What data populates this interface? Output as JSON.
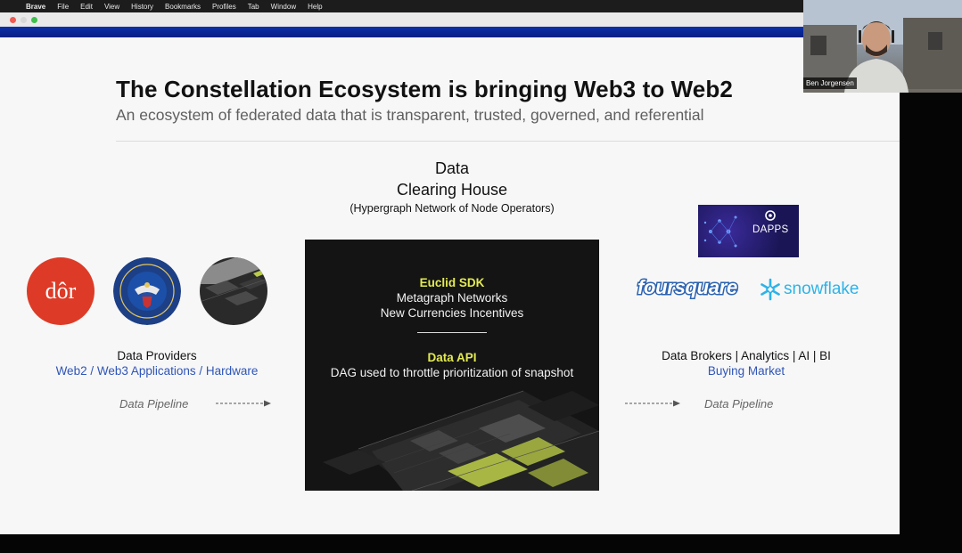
{
  "menubar": {
    "items": [
      "Brave",
      "File",
      "Edit",
      "View",
      "History",
      "Bookmarks",
      "Profiles",
      "Tab",
      "Window",
      "Help"
    ]
  },
  "slide": {
    "title": "The Constellation Ecosystem is bringing Web3 to Web2",
    "subtitle": "An ecosystem of federated data that is transparent, trusted, governed, and referential",
    "clearing_house": {
      "line1": "Data",
      "line2": "Clearing House",
      "line3": "(Hypergraph Network of Node Operators)"
    },
    "panel": {
      "sdk_title": "Euclid SDK",
      "sdk_line1": "Metagraph Networks",
      "sdk_line2": "New Currencies Incentives",
      "api_title": "Data API",
      "api_line1": "DAG used to throttle prioritization of snapshot"
    },
    "providers": {
      "logo_text": "dôr",
      "title": "Data Providers",
      "subtitle": "Web2 / Web3 Applications / Hardware",
      "pipeline": "Data Pipeline"
    },
    "brokers": {
      "dapps_label": "DAPPS",
      "foursquare": "foursquare",
      "snowflake": "snowflake",
      "title": "Data Brokers | Analytics | AI | BI",
      "subtitle": "Buying Market",
      "pipeline": "Data Pipeline"
    }
  },
  "webcam": {
    "name": "Ben Jorgensen"
  },
  "colors": {
    "accent_blue": "#2f55b8",
    "panel_yellow": "#e3ea52",
    "dor_red": "#dd3b27",
    "snowflake_blue": "#2db3e8",
    "browser_bar": "#0c2fa8"
  }
}
